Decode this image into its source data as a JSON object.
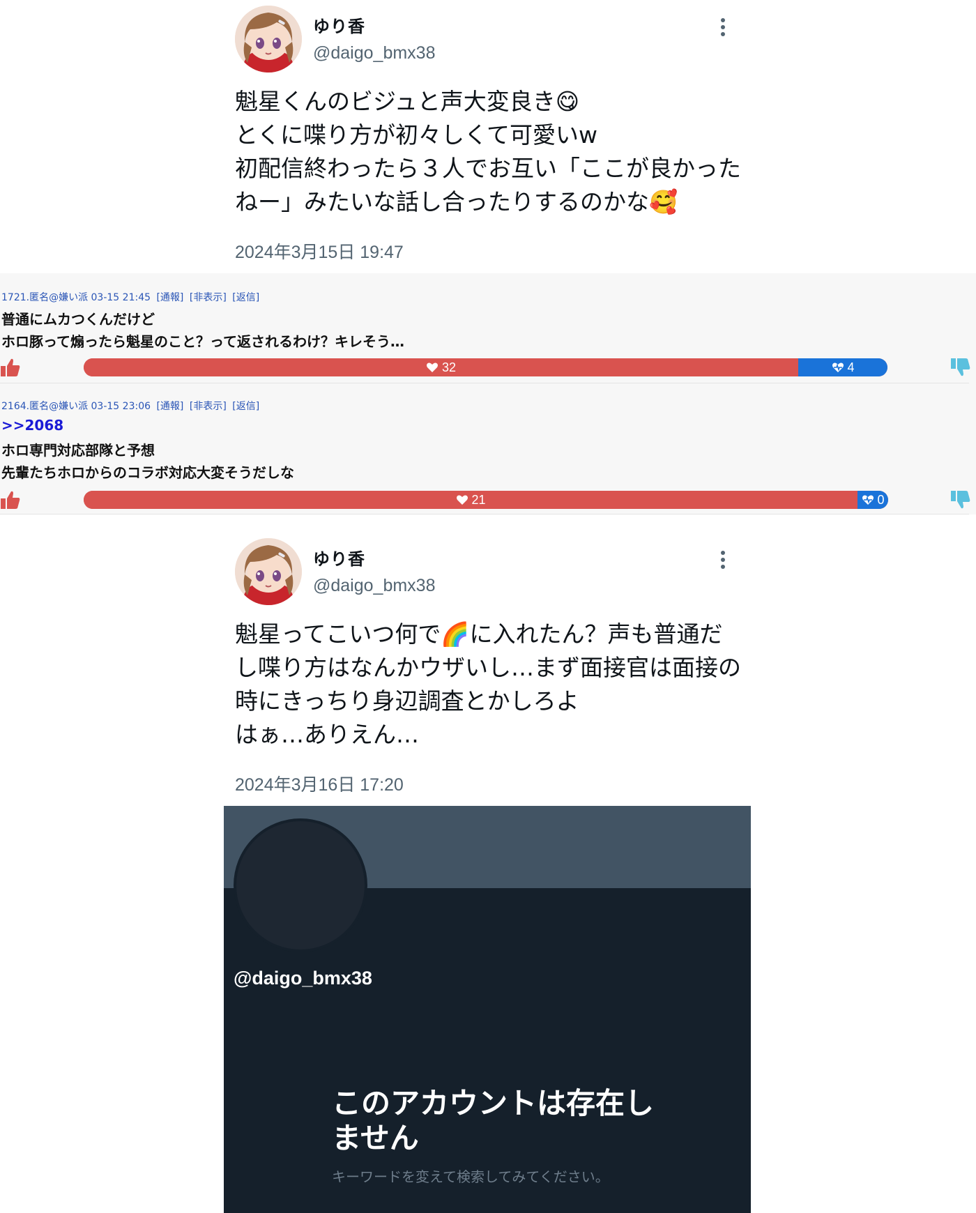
{
  "tweets": [
    {
      "name": "ゆり香",
      "handle": "@daigo_bmx38",
      "lines": [
        "魁星くんのビジュと声大変良き😋",
        "とくに喋り方が初々しくて可愛いw",
        "初配信終わったら３人でお互い「ここが良かった",
        "ねー」みたいな話し合ったりするのかな🥰"
      ],
      "time": "2024年3月15日 19:47"
    },
    {
      "name": "ゆり香",
      "handle": "@daigo_bmx38",
      "lines": [
        "魁星ってこいつ何で🌈に入れたん？声も普通だ",
        "し喋り方はなんかウザいし…まず面接官は面接の",
        "時にきっちり身辺調査とかしろよ",
        "はぁ…ありえん…"
      ],
      "time": "2024年3月16日 17:20"
    }
  ],
  "comments": [
    {
      "meta": "1721.匿名@嫌い派 03-15 21:45",
      "actions": [
        "[通報]",
        "[非表示]",
        "[返信]"
      ],
      "anchor": "",
      "lines": [
        "普通にムカつくんだけど",
        "ホロ豚って煽ったら魁星のこと？って返されるわけ？キレそう…"
      ],
      "likes": 32,
      "dislikes": 4,
      "likes_label": "32",
      "dislikes_label": "4"
    },
    {
      "meta": "2164.匿名@嫌い派 03-15 23:06",
      "actions": [
        "[通報]",
        "[非表示]",
        "[返信]"
      ],
      "anchor": ">>2068",
      "lines": [
        "ホロ専門対応部隊と予想",
        "先輩たちホロからのコラボ対応大変そうだしな"
      ],
      "likes": 21,
      "dislikes": 0,
      "likes_label": "21",
      "dislikes_label": "0"
    }
  ],
  "deleted_account": {
    "handle": "@daigo_bmx38",
    "title_lines": [
      "このアカウントは存在し",
      "ません"
    ],
    "subtitle": "キーワードを変えて検索してみてください。"
  },
  "colors": {
    "like_bar": "#d9534f",
    "dislike_bar": "#1a73d9",
    "thumb_up": "#d9534f",
    "thumb_down": "#5bc0de",
    "meta_link": "#2a55b6",
    "anchor": "#1a1ad6",
    "deleted_bg": "#15202b",
    "deleted_banner": "#425464"
  },
  "icons": {
    "tweet_more": "more-vertical-icon",
    "thumb_up": "thumbs-up-icon",
    "thumb_down": "thumbs-down-icon",
    "like": "heart-icon",
    "dislike": "heart-broken-icon"
  }
}
